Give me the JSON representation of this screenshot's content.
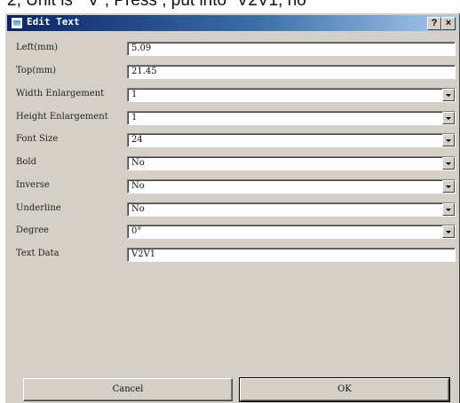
{
  "page_caption": "2,  Unit is “ V”,   Press           , put into “V2V1, no",
  "dialog": {
    "title": "Edit Text",
    "help_label": "?",
    "close_label": "×"
  },
  "fields": [
    {
      "label": "Left(mm)",
      "value": "5.09",
      "type": "text"
    },
    {
      "label": "Top(mm)",
      "value": "21.45",
      "type": "text"
    },
    {
      "label": "Width Enlargement",
      "value": "1",
      "type": "select"
    },
    {
      "label": "Height Enlargement",
      "value": "1",
      "type": "select"
    },
    {
      "label": "Font Size",
      "value": "24",
      "type": "select"
    },
    {
      "label": "Bold",
      "value": "No",
      "type": "select"
    },
    {
      "label": "Inverse",
      "value": "No",
      "type": "select"
    },
    {
      "label": "Underline",
      "value": "No",
      "type": "select"
    },
    {
      "label": "Degree",
      "value": "0°",
      "type": "select"
    },
    {
      "label": "Text Data",
      "value": "V2V1",
      "type": "text"
    }
  ],
  "buttons": {
    "cancel": "Cancel",
    "ok": "OK"
  }
}
